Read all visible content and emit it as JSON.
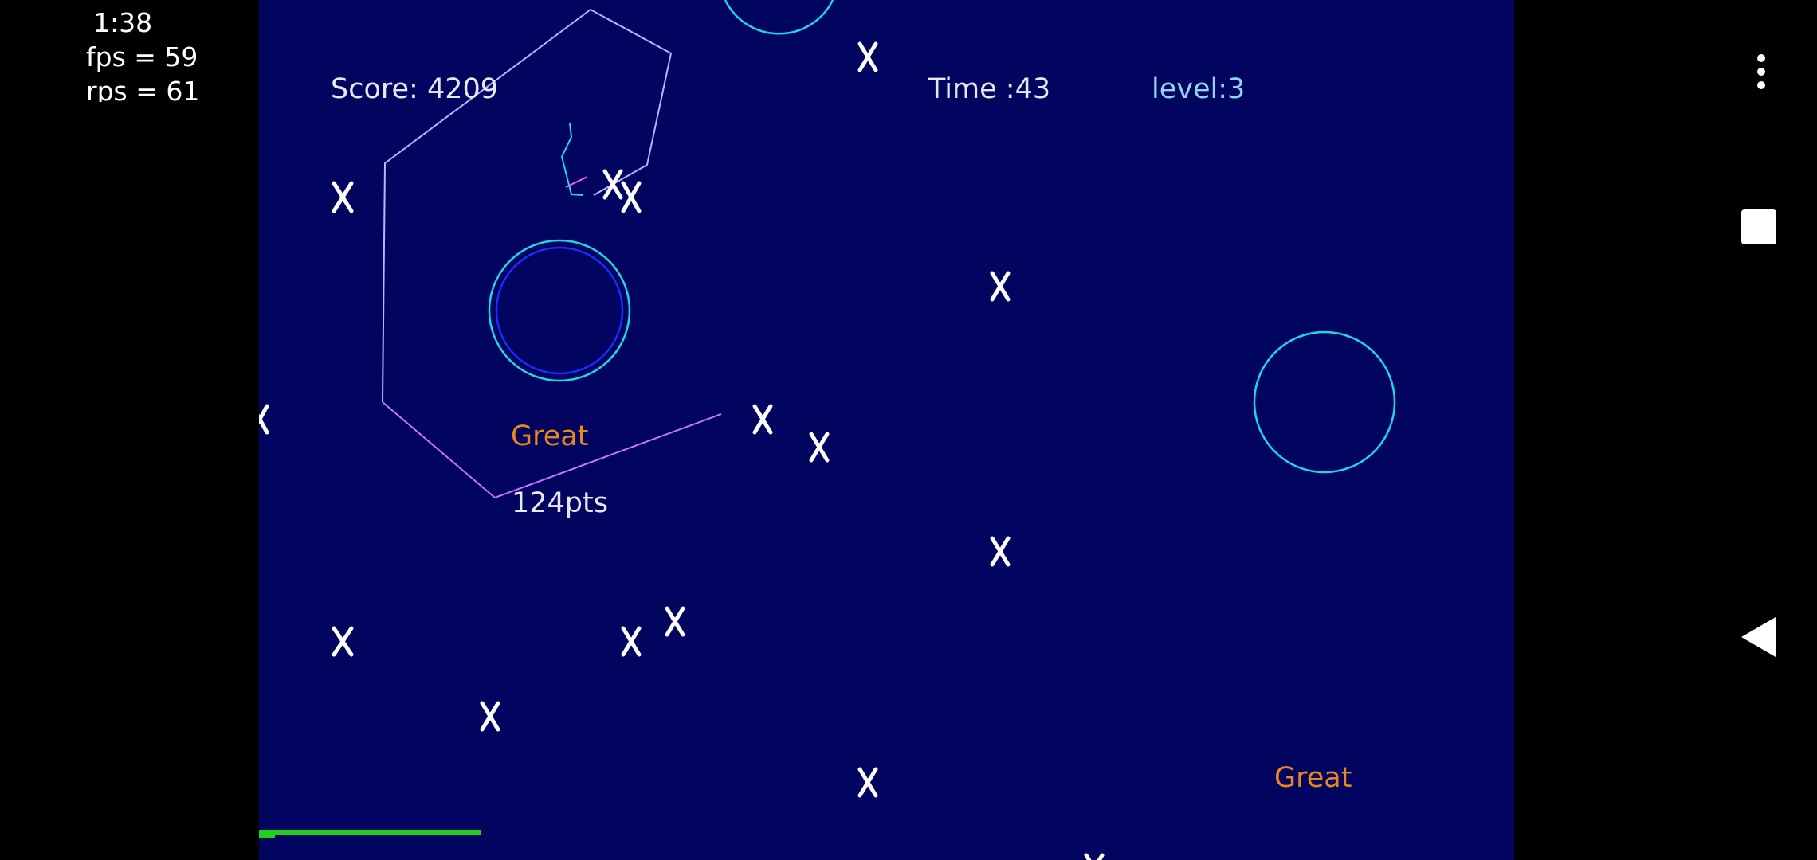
{
  "debug": {
    "clock": "1:38",
    "fps": "fps = 59",
    "rps": "rps = 61"
  },
  "hud": {
    "score": "Score: 4209",
    "time": "Time :43",
    "level": "level:3"
  },
  "floating_text": {
    "great_1": "Great",
    "points_1": "124pts",
    "great_2": "Great"
  },
  "colors": {
    "background": "#020560",
    "star": "#ffffff",
    "ring": "#1ed6e6",
    "ring_inner": "#1a2cff",
    "trail": "#b7b7ff",
    "trail_tail": "#c873ff",
    "accent_text": "#e8871e",
    "level_text": "#8fd3f0",
    "power_bar": "#1fd11f"
  },
  "icons": {
    "menu": "overflow-menu-icon",
    "recents": "recents-square-icon",
    "back": "back-triangle-icon"
  }
}
